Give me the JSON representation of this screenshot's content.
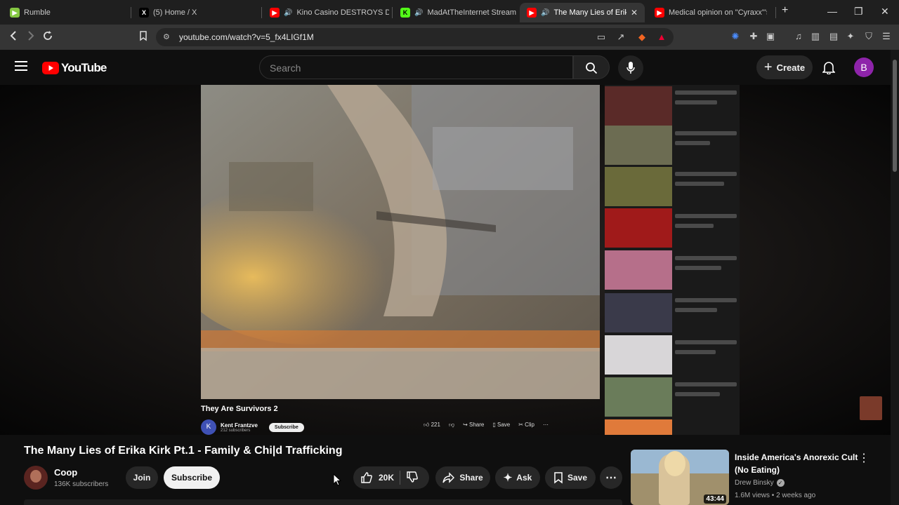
{
  "browser": {
    "tabs": [
      {
        "title": "Rumble",
        "color": "#85c742"
      },
      {
        "title": "(5) Home / X",
        "color": "#000000"
      },
      {
        "title": "Kino Casino DESTROYS DSP",
        "color": "#ff0000"
      },
      {
        "title": "MadAtTheInternet Stream -",
        "color": "#53fc18"
      },
      {
        "title": "The Many Lies of Erika K",
        "color": "#ff0000"
      },
      {
        "title": "Medical opinion on \"Cyraxx\"'s m",
        "color": "#ff0000"
      }
    ],
    "url": "youtube.com/watch?v=5_fx4LIGf1M",
    "new_tab": "+"
  },
  "youtube": {
    "logo": "YouTube",
    "search_placeholder": "Search",
    "create_label": "Create",
    "avatar_letter": "B"
  },
  "embedded": {
    "title": "They Are Survivors 2",
    "channel": "Kent Frantzve",
    "subscribers": "212 subscribers",
    "channel_initial": "K",
    "subscribe": "Subscribe",
    "likes": "221",
    "share": "Share",
    "save": "Save",
    "clip": "Clip"
  },
  "video": {
    "title": "The Many Lies of Erika Kirk Pt.1 - Family & Chi|d Trafficking",
    "channel": "Coop",
    "subscribers": "136K subscribers",
    "join": "Join",
    "subscribe": "Subscribe",
    "likes": "20K",
    "share": "Share",
    "ask": "Ask",
    "save": "Save"
  },
  "recommendation": {
    "title_line1": "Inside America's Anorexic Cult",
    "title_line2": "(No Eating)",
    "channel": "Drew Binsky",
    "meta": "1.6M views • 2 weeks ago",
    "duration": "43:44"
  }
}
